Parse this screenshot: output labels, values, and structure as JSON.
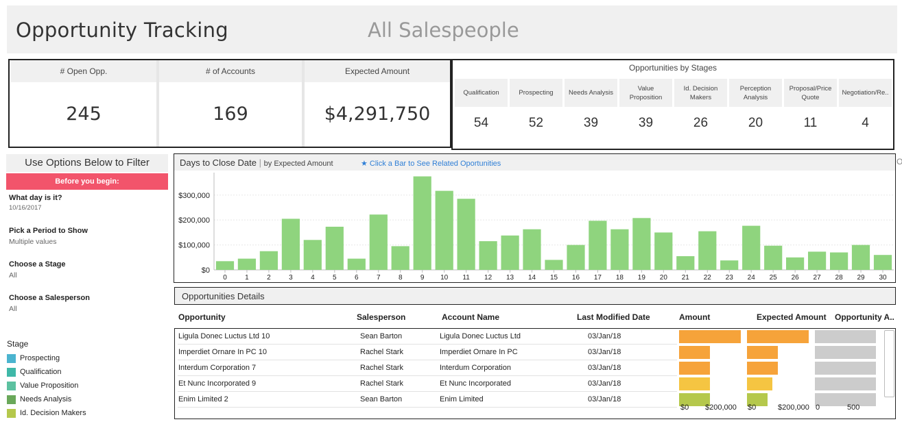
{
  "header": {
    "title": "Opportunity Tracking",
    "subtitle": "All Salespeople"
  },
  "kpis": [
    {
      "label": "# Open Opp.",
      "value": "245"
    },
    {
      "label": "# of Accounts",
      "value": "169"
    },
    {
      "label": "Expected Amount",
      "value": "$4,291,750"
    }
  ],
  "stages": {
    "title": "Opportunities by Stages",
    "items": [
      {
        "label": "Qualification",
        "value": "54"
      },
      {
        "label": "Prospecting",
        "value": "52"
      },
      {
        "label": "Needs Analysis",
        "value": "39"
      },
      {
        "label": "Value Proposition",
        "value": "39"
      },
      {
        "label": "Id. Decision Makers",
        "value": "26"
      },
      {
        "label": "Perception Analysis",
        "value": "20"
      },
      {
        "label": "Proposal/Price Quote",
        "value": "11"
      },
      {
        "label": "Negotiation/Re..",
        "value": "4"
      }
    ]
  },
  "filters": {
    "title": "Use Options Below to Filter",
    "banner": "Before you begin:",
    "day_label": "What day is it?",
    "day_value": "10/16/2017",
    "period_label": "Pick a Period to Show",
    "period_value": "Multiple values",
    "stage_label": "Choose a Stage",
    "stage_value": "All",
    "salesperson_label": "Choose a Salesperson",
    "salesperson_value": "All"
  },
  "legend": {
    "title": "Stage",
    "items": [
      {
        "label": "Prospecting",
        "color": "#4bb4cf"
      },
      {
        "label": "Qualification",
        "color": "#3fb8a8"
      },
      {
        "label": "Value Proposition",
        "color": "#5cc1a0"
      },
      {
        "label": "Needs Analysis",
        "color": "#6aa85a"
      },
      {
        "label": "Id. Decision Makers",
        "color": "#b5c84c"
      }
    ]
  },
  "chart": {
    "title": "Days to Close Date",
    "subtitle": "by Expected Amount",
    "hint": "★  Click a Bar to See Related Oportunities",
    "edge_text": "O",
    "bar_color": "#8fd47e"
  },
  "chart_data": {
    "type": "bar",
    "categories": [
      "0",
      "1",
      "2",
      "3",
      "4",
      "5",
      "6",
      "7",
      "8",
      "9",
      "10",
      "11",
      "12",
      "13",
      "14",
      "15",
      "16",
      "17",
      "18",
      "19",
      "20",
      "21",
      "22",
      "23",
      "24",
      "25",
      "26",
      "27",
      "28",
      "29",
      "30"
    ],
    "values": [
      35000,
      45000,
      75000,
      205000,
      120000,
      173000,
      45000,
      222000,
      95000,
      375000,
      317000,
      285000,
      115000,
      138000,
      163000,
      40000,
      100000,
      197000,
      163000,
      208000,
      150000,
      55000,
      155000,
      38000,
      177000,
      97000,
      50000,
      73000,
      70000,
      100000,
      60000
    ],
    "ylim": [
      0,
      390000
    ],
    "yticks": [
      0,
      100000,
      200000,
      300000
    ],
    "ytick_labels": [
      "$0",
      "$100,000",
      "$200,000",
      "$300,000"
    ],
    "xlabel": "",
    "ylabel": "",
    "grid": true
  },
  "details": {
    "title": "Opportunities Details",
    "columns": [
      "Opportunity",
      "Salesperson",
      "Account Name",
      "Last Modified Date",
      "Amount",
      "Expected Amount",
      "Opportunity A.."
    ],
    "rows": [
      {
        "opportunity": "Ligula Donec Luctus Ltd 10",
        "salesperson": "Sean Barton",
        "account": "Ligula Donec Luctus Ltd",
        "modified": "03/Jan/18",
        "amount": 200000,
        "expected": 200000,
        "age": 460,
        "color": "#f6a33a"
      },
      {
        "opportunity": "Imperdiet Ornare In PC 10",
        "salesperson": "Rachel Stark",
        "account": "Imperdiet Ornare In PC",
        "modified": "03/Jan/18",
        "amount": 100000,
        "expected": 100000,
        "age": 460,
        "color": "#f6a33a"
      },
      {
        "opportunity": "Interdum Corporation 7",
        "salesperson": "Rachel Stark",
        "account": "Interdum Corporation",
        "modified": "03/Jan/18",
        "amount": 100000,
        "expected": 100000,
        "age": 460,
        "color": "#f6a33a"
      },
      {
        "opportunity": "Et Nunc Incorporated 9",
        "salesperson": "Rachel Stark",
        "account": "Et Nunc Incorporated",
        "modified": "03/Jan/18",
        "amount": 100000,
        "expected": 83000,
        "age": 460,
        "color": "#f5c542"
      },
      {
        "opportunity": "Enim Limited 2",
        "salesperson": "Sean Barton",
        "account": "Enim Limited",
        "modified": "03/Jan/18",
        "amount": 100000,
        "expected": 66000,
        "age": 460,
        "color": "#b5c84c"
      }
    ],
    "axis_amount": [
      "$0",
      "$200,000"
    ],
    "axis_expected": [
      "$0",
      "$200,000"
    ],
    "axis_age": [
      "0",
      "500"
    ],
    "age_bar_color": "#cccccc"
  }
}
